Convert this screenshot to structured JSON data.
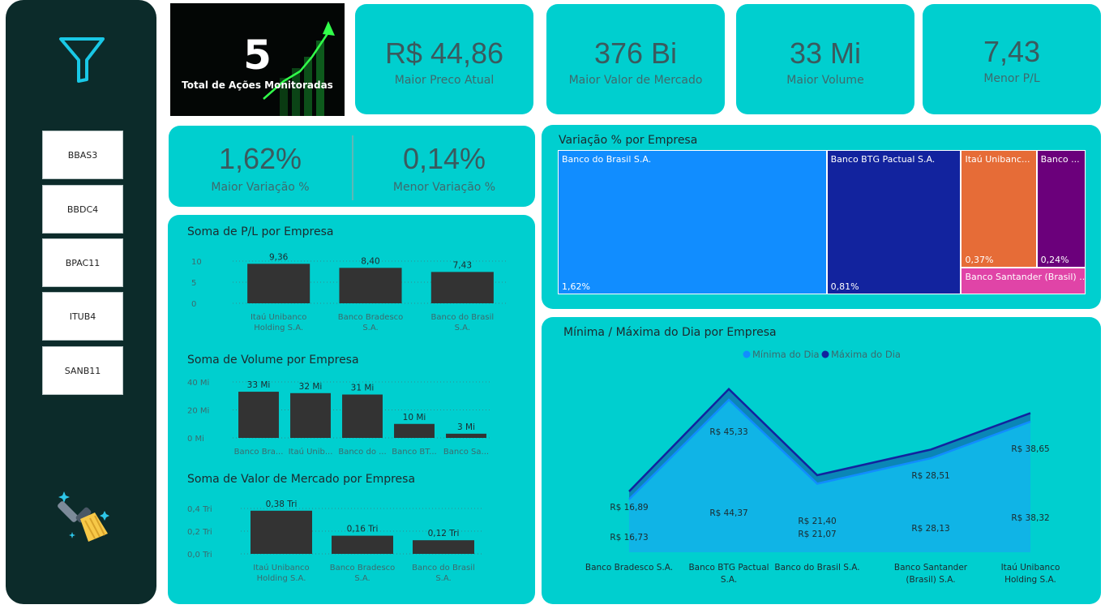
{
  "slicer": {
    "items": [
      "BBAS3",
      "BBDC4",
      "BPAC11",
      "ITUB4",
      "SANB11"
    ]
  },
  "hero": {
    "value": "5",
    "label": "Total de Ações Monitoradas"
  },
  "kpis": [
    {
      "value": "R$ 44,86",
      "label": "Maior Preco Atual"
    },
    {
      "value": "376 Bi",
      "label": "Maior Valor de Mercado"
    },
    {
      "value": "33 Mi",
      "label": "Maior Volume"
    },
    {
      "value": "7,43",
      "label": "Menor P/L"
    }
  ],
  "variation": {
    "max_value": "1,62%",
    "max_label": "Maior Variação %",
    "min_value": "0,14%",
    "min_label": "Menor Variação %"
  },
  "colors": {
    "card": "#00cfcf",
    "bar": "#333333",
    "sidebar": "#0c2b2a"
  },
  "chart_data": [
    {
      "type": "bar",
      "title": "Soma de P/L por Empresa",
      "categories": [
        "Itaú Unibanco Holding S.A.",
        "Banco Bradesco S.A.",
        "Banco do Brasil S.A."
      ],
      "category_lines": [
        [
          "Itaú Unibanco",
          "Holding S.A."
        ],
        [
          "Banco Bradesco",
          "S.A."
        ],
        [
          "Banco do Brasil",
          "S.A."
        ]
      ],
      "values": [
        9.36,
        8.4,
        7.43
      ],
      "data_labels": [
        "9,36",
        "8,40",
        "7,43"
      ],
      "yticks": [
        {
          "v": 0,
          "t": "0"
        },
        {
          "v": 5,
          "t": "5"
        },
        {
          "v": 10,
          "t": "10"
        }
      ],
      "ylim": [
        0,
        10
      ]
    },
    {
      "type": "bar",
      "title": "Soma de Volume por Empresa",
      "categories": [
        "Banco Bra...",
        "Itaú Unib...",
        "Banco do ...",
        "Banco BT...",
        "Banco Sa..."
      ],
      "category_lines": [
        [
          "Banco Bra..."
        ],
        [
          "Itaú Unib..."
        ],
        [
          "Banco do ..."
        ],
        [
          "Banco BT..."
        ],
        [
          "Banco Sa..."
        ]
      ],
      "values": [
        33,
        32,
        31,
        10,
        3
      ],
      "data_labels": [
        "33 Mi",
        "32 Mi",
        "31 Mi",
        "10 Mi",
        "3 Mi"
      ],
      "yticks": [
        {
          "v": 0,
          "t": "0 Mi"
        },
        {
          "v": 20,
          "t": "20 Mi"
        },
        {
          "v": 40,
          "t": "40 Mi"
        }
      ],
      "ylim": [
        0,
        40
      ]
    },
    {
      "type": "bar",
      "title": "Soma de Valor de Mercado por Empresa",
      "categories": [
        "Itaú Unibanco Holding S.A.",
        "Banco Bradesco S.A.",
        "Banco do Brasil S.A."
      ],
      "category_lines": [
        [
          "Itaú Unibanco",
          "Holding S.A."
        ],
        [
          "Banco Bradesco",
          "S.A."
        ],
        [
          "Banco do Brasil",
          "S.A."
        ]
      ],
      "values": [
        0.38,
        0.16,
        0.12
      ],
      "data_labels": [
        "0,38 Tri",
        "0,16 Tri",
        "0,12 Tri"
      ],
      "yticks": [
        {
          "v": 0,
          "t": "0,0 Tri"
        },
        {
          "v": 0.2,
          "t": "0,2 Tri"
        },
        {
          "v": 0.4,
          "t": "0,4 Tri"
        }
      ],
      "ylim": [
        0,
        0.4
      ]
    },
    {
      "type": "treemap",
      "title": "Variação % por Empresa",
      "items": [
        {
          "name": "Banco do Brasil S.A.",
          "value": 1.62,
          "label": "1,62%",
          "color": "#118dff"
        },
        {
          "name": "Banco BTG Pactual S.A.",
          "value": 0.81,
          "label": "0,81%",
          "color": "#12239e"
        },
        {
          "name": "Itaú Unibanc...",
          "value": 0.37,
          "label": "0,37%",
          "color": "#e66c37"
        },
        {
          "name": "Banco ...",
          "value": 0.24,
          "label": "0,24%",
          "color": "#6b007b"
        },
        {
          "name": "Banco Santander (Brasil) ...",
          "value": 0.14,
          "label": "",
          "color": "#e044a7"
        }
      ]
    },
    {
      "type": "area",
      "title": "Mínima / Máxima do Dia por Empresa",
      "legend_position": "top-center",
      "categories": [
        "Banco Bradesco S.A.",
        "Banco BTG Pactual S.A.",
        "Banco do Brasil S.A.",
        "Banco Santander (Brasil) S.A.",
        "Itaú Unibanco Holding S.A."
      ],
      "category_lines": [
        [
          "Banco Bradesco S.A."
        ],
        [
          "Banco BTG Pactual",
          "S.A."
        ],
        [
          "Banco do Brasil S.A."
        ],
        [
          "Banco Santander",
          "(Brasil) S.A."
        ],
        [
          "Itaú Unibanco",
          "Holding S.A."
        ]
      ],
      "series": [
        {
          "name": "Mínima do Dia",
          "values": [
            16.73,
            44.37,
            21.07,
            28.13,
            38.32
          ],
          "labels": [
            "R$ 16,73",
            "R$ 44,37",
            "R$ 21,07",
            "R$ 28,13",
            "R$ 38,32"
          ],
          "color": "#118dff"
        },
        {
          "name": "Máxima do Dia",
          "values": [
            16.89,
            45.33,
            21.4,
            28.51,
            38.65
          ],
          "labels": [
            "R$ 16,89",
            "R$ 45,33",
            "R$ 21,40",
            "R$ 28,51",
            "R$ 38,65"
          ],
          "color": "#12239e"
        }
      ]
    }
  ]
}
